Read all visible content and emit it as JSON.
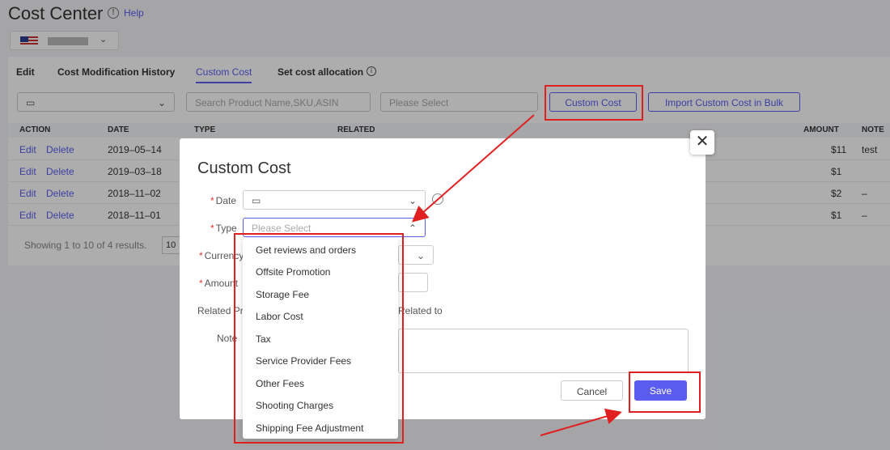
{
  "page": {
    "title": "Cost Center",
    "help": "Help"
  },
  "tabs": [
    "Edit",
    "Cost Modification History",
    "Custom Cost",
    "Set cost allocation"
  ],
  "filters": {
    "search_placeholder": "Search Product Name,SKU,ASIN",
    "type_placeholder": "Please Select",
    "custom_cost_button": "Custom Cost",
    "import_button": "Import Custom Cost in Bulk"
  },
  "table": {
    "headers": [
      "ACTION",
      "DATE",
      "TYPE",
      "RELATED",
      "AMOUNT",
      "NOTE"
    ],
    "rows": [
      {
        "edit": "Edit",
        "delete": "Delete",
        "date": "2019–05–14",
        "amount": "$11",
        "note": "test"
      },
      {
        "edit": "Edit",
        "delete": "Delete",
        "date": "2019–03–18",
        "amount": "$1",
        "note": ""
      },
      {
        "edit": "Edit",
        "delete": "Delete",
        "date": "2018–11–02",
        "amount": "$2",
        "note": "–"
      },
      {
        "edit": "Edit",
        "delete": "Delete",
        "date": "2018–11–01",
        "amount": "$1",
        "note": "–"
      }
    ],
    "pager_text": "Showing 1 to 10 of 4 results.",
    "page_size": "10"
  },
  "modal": {
    "title": "Custom Cost",
    "date_label": "Date",
    "type_label": "Type",
    "type_placeholder": "Please Select",
    "currency_label": "Currency",
    "amount_label": "Amount",
    "related_label": "Related Pr",
    "related_to": "Related to",
    "note_label": "Note",
    "cancel": "Cancel",
    "save": "Save"
  },
  "type_options": [
    "Get reviews and orders",
    "Offsite Promotion",
    "Storage Fee",
    "Labor Cost",
    "Tax",
    "Service Provider Fees",
    "Other Fees",
    "Shooting Charges",
    "Shipping Fee Adjustment"
  ],
  "colors": {
    "accent": "#5a5df0",
    "highlight": "#e02020"
  }
}
